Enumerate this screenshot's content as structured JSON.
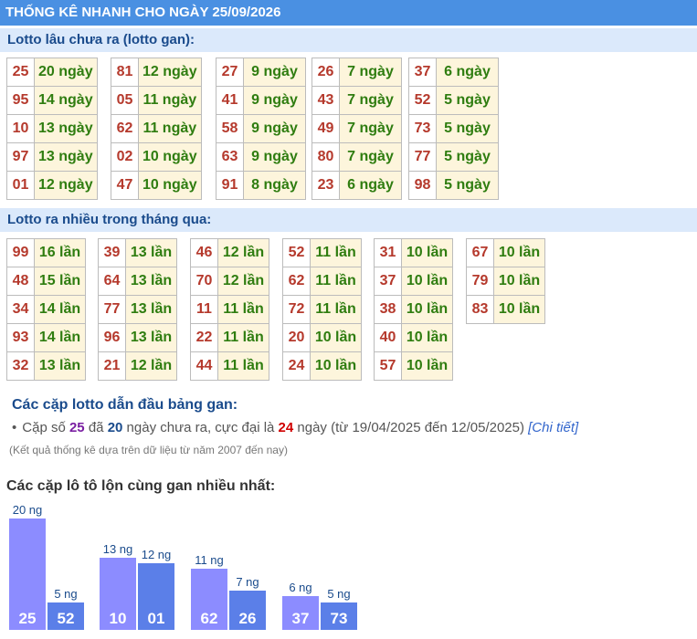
{
  "header": {
    "title": "THỐNG KÊ NHANH CHO NGÀY 25/09/2026"
  },
  "sections": {
    "gan_title": "Lotto lâu chưa ra (lotto gan):",
    "nhieu_title": "Lotto ra nhiều trong tháng qua:"
  },
  "gan_tables": [
    [
      [
        "25",
        "20 ngày"
      ],
      [
        "95",
        "14 ngày"
      ],
      [
        "10",
        "13 ngày"
      ],
      [
        "97",
        "13 ngày"
      ],
      [
        "01",
        "12 ngày"
      ]
    ],
    [
      [
        "81",
        "12 ngày"
      ],
      [
        "05",
        "11 ngày"
      ],
      [
        "62",
        "11 ngày"
      ],
      [
        "02",
        "10 ngày"
      ],
      [
        "47",
        "10 ngày"
      ]
    ],
    [
      [
        "27",
        "9 ngày"
      ],
      [
        "41",
        "9 ngày"
      ],
      [
        "58",
        "9 ngày"
      ],
      [
        "63",
        "9 ngày"
      ],
      [
        "91",
        "8 ngày"
      ]
    ],
    [
      [
        "26",
        "7 ngày"
      ],
      [
        "43",
        "7 ngày"
      ],
      [
        "49",
        "7 ngày"
      ],
      [
        "80",
        "7 ngày"
      ],
      [
        "23",
        "6 ngày"
      ]
    ],
    [
      [
        "37",
        "6 ngày"
      ],
      [
        "52",
        "5 ngày"
      ],
      [
        "73",
        "5 ngày"
      ],
      [
        "77",
        "5 ngày"
      ],
      [
        "98",
        "5 ngày"
      ]
    ]
  ],
  "nhieu_tables": [
    [
      [
        "99",
        "16 lần"
      ],
      [
        "48",
        "15 lần"
      ],
      [
        "34",
        "14 lần"
      ],
      [
        "93",
        "14 lần"
      ],
      [
        "32",
        "13 lần"
      ]
    ],
    [
      [
        "39",
        "13 lần"
      ],
      [
        "64",
        "13 lần"
      ],
      [
        "77",
        "13 lần"
      ],
      [
        "96",
        "13 lần"
      ],
      [
        "21",
        "12 lần"
      ]
    ],
    [
      [
        "46",
        "12 lần"
      ],
      [
        "70",
        "12 lần"
      ],
      [
        "11",
        "11 lần"
      ],
      [
        "22",
        "11 lần"
      ],
      [
        "44",
        "11 lần"
      ]
    ],
    [
      [
        "52",
        "11 lần"
      ],
      [
        "62",
        "11 lần"
      ],
      [
        "72",
        "11 lần"
      ],
      [
        "20",
        "10 lần"
      ],
      [
        "24",
        "10 lần"
      ]
    ],
    [
      [
        "31",
        "10 lần"
      ],
      [
        "37",
        "10 lần"
      ],
      [
        "38",
        "10 lần"
      ],
      [
        "40",
        "10 lần"
      ],
      [
        "57",
        "10 lần"
      ]
    ],
    [
      [
        "67",
        "10 lần"
      ],
      [
        "79",
        "10 lần"
      ],
      [
        "83",
        "10 lần"
      ]
    ]
  ],
  "pairs": {
    "title": "Các cặp lotto dẫn đầu bảng gan:",
    "text1": "Cặp số ",
    "num": "25",
    "text2": " đã ",
    "days": "20",
    "text3": " ngày chưa ra, cực đại là ",
    "max": "24",
    "text4": " ngày (từ 19/04/2025 đến 12/05/2025) ",
    "link": "[Chi tiết]",
    "note": "(Kết quả thống kê dựa trên dữ liệu từ năm 2007 đến nay)"
  },
  "chart_data": {
    "type": "bar",
    "title": "Các cặp lô tô lộn cùng gan nhiều nhất:",
    "groups": [
      {
        "bars": [
          {
            "label": "25",
            "value": 20,
            "text": "20 ng"
          },
          {
            "label": "52",
            "value": 5,
            "text": "5 ng"
          }
        ]
      },
      {
        "bars": [
          {
            "label": "10",
            "value": 13,
            "text": "13 ng"
          },
          {
            "label": "01",
            "value": 12,
            "text": "12 ng"
          }
        ]
      },
      {
        "bars": [
          {
            "label": "62",
            "value": 11,
            "text": "11 ng"
          },
          {
            "label": "26",
            "value": 7,
            "text": "7 ng"
          }
        ]
      },
      {
        "bars": [
          {
            "label": "37",
            "value": 6,
            "text": "6 ng"
          },
          {
            "label": "73",
            "value": 5,
            "text": "5 ng"
          }
        ]
      }
    ],
    "colors": {
      "first": "#8c8cff",
      "second": "#5b7fe8"
    }
  }
}
